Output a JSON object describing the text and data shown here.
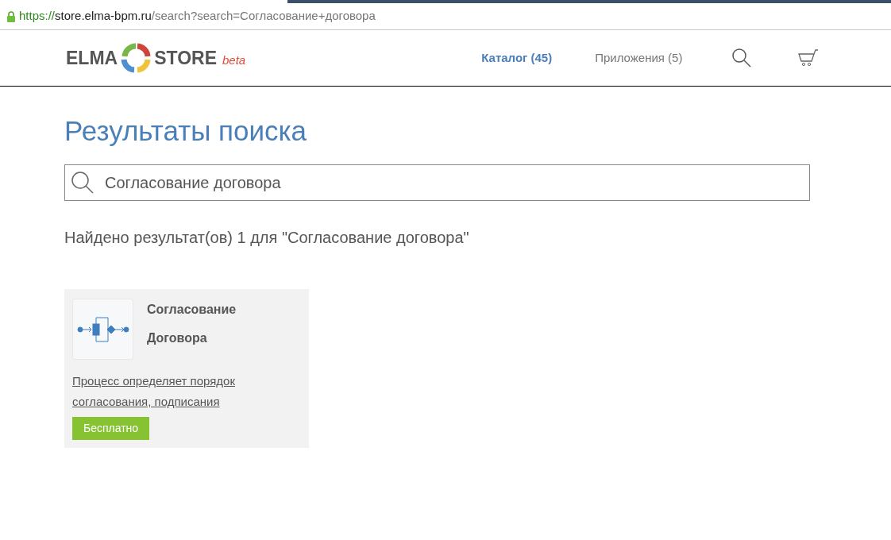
{
  "address_bar": {
    "scheme": "https://",
    "host": "store.elma-bpm.ru",
    "path": "/search?search=Согласование+договора"
  },
  "logo": {
    "left": "ELMA",
    "right": "STORE",
    "badge": "beta"
  },
  "nav": [
    {
      "label": "Каталог (45)",
      "selected": true
    },
    {
      "label": "Приложения (5)",
      "selected": false
    }
  ],
  "page_title": "Результаты поиска",
  "search": {
    "value": "Согласование договора"
  },
  "summary": "Найдено результат(ов) 1 для \"Согласование договора\"",
  "results": [
    {
      "title": "Согласование Договора",
      "description": "Процесс определяет порядок согласования, подписания",
      "price": "Бесплатно"
    }
  ]
}
